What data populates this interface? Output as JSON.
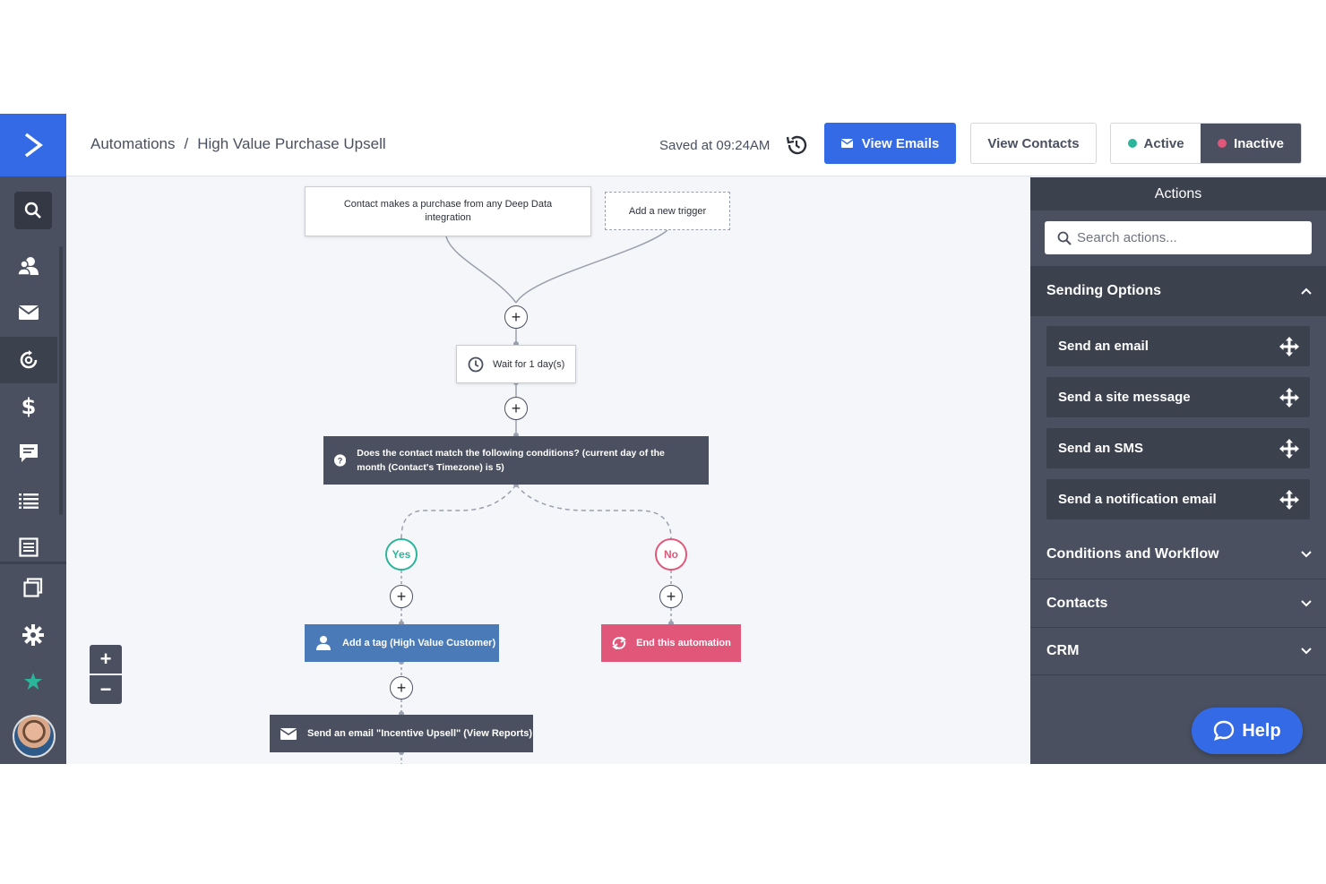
{
  "breadcrumb": {
    "root": "Automations",
    "separator": "/",
    "current": "High Value Purchase Upsell"
  },
  "header": {
    "saved_text": "Saved at 09:24AM",
    "view_emails": "View Emails",
    "view_contacts": "View Contacts",
    "status_active": "Active",
    "status_inactive": "Inactive",
    "selected_status": "Inactive"
  },
  "nav": {
    "icons": [
      "logo-icon",
      "search-icon",
      "contacts-icon",
      "email-icon",
      "automations-icon",
      "deals-icon",
      "conversations-icon",
      "lists-icon",
      "reports-icon",
      "pages-icon",
      "settings-icon",
      "star-icon",
      "avatar"
    ],
    "active_item": "automations-icon"
  },
  "workflow": {
    "trigger": "Contact makes a purchase from any Deep Data integration",
    "add_trigger": "Add a new trigger",
    "wait": "Wait for 1 day(s)",
    "condition": "Does the contact match the following conditions? (current day of the month (Contact's Timezone) is 5)",
    "yes": "Yes",
    "no": "No",
    "tag": "Add a tag (High Value Customer)",
    "end": "End this automation",
    "email": "Send an email \"Incentive Upsell\" (View Reports)",
    "plus": "+"
  },
  "zoom": {
    "in": "+",
    "out": "−"
  },
  "panel": {
    "title": "Actions",
    "search_placeholder": "Search actions...",
    "open_section": "Sending Options",
    "actions": [
      "Send an email",
      "Send a site message",
      "Send an SMS",
      "Send a notification email"
    ],
    "sections": [
      "Conditions and Workflow",
      "Contacts",
      "CRM"
    ],
    "help": "Help"
  },
  "colors": {
    "brand_blue": "#356ae6",
    "nav_dark": "#4a505f",
    "yes_green": "#2bb59a",
    "no_pink": "#e0577a",
    "tag_blue": "#4a7ab8",
    "star_green": "#2bb59a"
  }
}
